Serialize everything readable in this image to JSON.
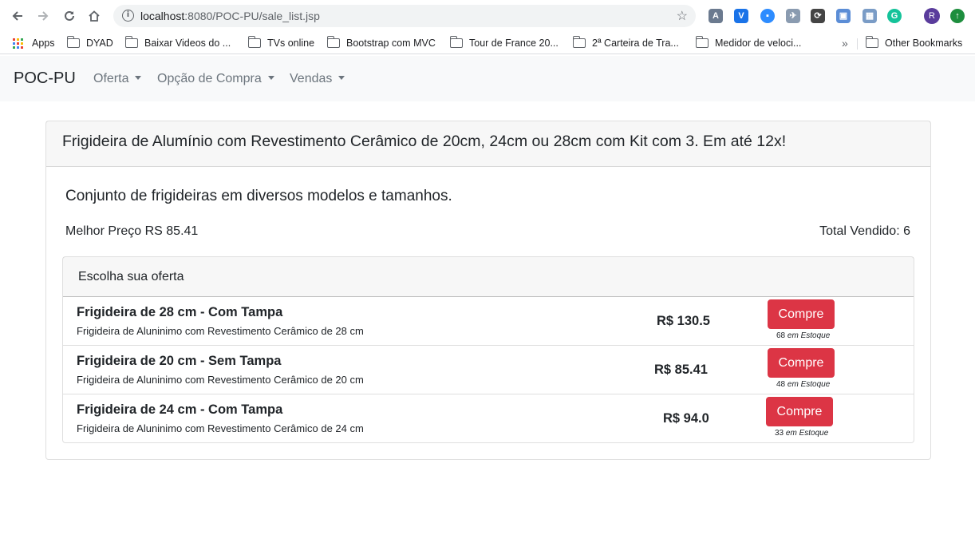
{
  "browser": {
    "url_host": "localhost",
    "url_path": ":8080/POC-PU/sale_list.jsp",
    "bookmarks": [
      "Apps",
      "DYAD",
      "Baixar Videos do ...",
      "TVs online",
      "Bootstrap com MVC",
      "Tour de France 20...",
      "2ª Carteira de Tra...",
      "Medidor de veloci..."
    ],
    "overflow_label": "»",
    "other_bookmarks": "Other Bookmarks",
    "profile_initial": "R"
  },
  "navbar": {
    "brand": "POC-PU",
    "items": [
      "Oferta",
      "Opção de Compra",
      "Vendas"
    ]
  },
  "product": {
    "title": "Frigideira de Alumínio com Revestimento Cerâmico de 20cm, 24cm ou 28cm com Kit com 3. Em até 12x!",
    "subtitle": "Conjunto de frigideiras em diversos modelos e tamanhos.",
    "best_price": "Melhor Preço RS 85.41",
    "total_sold": "Total Vendido: 6",
    "offers_header": "Escolha sua oferta",
    "offers": [
      {
        "name": "Frigideira de 28 cm - Com Tampa",
        "description": "Frigideira de Aluninimo com Revestimento Cerâmico de 28 cm",
        "price": "R$ 130.5",
        "button": "Compre",
        "stock_count": "68",
        "stock_label": "em Estoque"
      },
      {
        "name": "Frigideira de 20 cm - Sem Tampa",
        "description": "Frigideira de Aluninimo com Revestimento Cerâmico de 20 cm",
        "price": "R$ 85.41",
        "button": "Compre",
        "stock_count": "48",
        "stock_label": "em Estoque"
      },
      {
        "name": "Frigideira de 24 cm - Com Tampa",
        "description": "Frigideira de Aluninimo com Revestimento Cerâmico de 24 cm",
        "price": "R$ 94.0",
        "button": "Compre",
        "stock_count": "33",
        "stock_label": "em Estoque"
      }
    ]
  },
  "colors": {
    "buy_button": "#dc3545",
    "navbar_bg": "#f8f9fa"
  }
}
